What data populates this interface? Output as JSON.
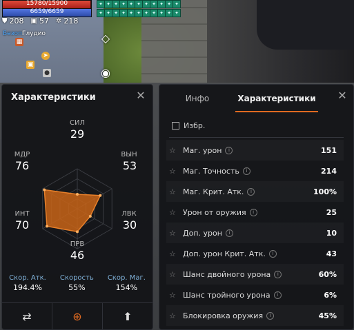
{
  "hud": {
    "hp_text": "15780/15900",
    "hp_fraction": 0.9925,
    "mp_text": "6659/6659",
    "mp_fraction": 1.0,
    "stats": [
      {
        "icon": "shield-icon",
        "glyph": "⛊",
        "value": "208"
      },
      {
        "icon": "helmet-icon",
        "glyph": "▣",
        "value": "57"
      },
      {
        "icon": "gear-icon",
        "glyph": "✲",
        "value": "218"
      }
    ],
    "zone_prefix": "Безоп",
    "zone_name": "Глудио",
    "colors": {
      "zone_safe": "#4aa8ff",
      "buff": "#1a8a6a"
    }
  },
  "left_panel": {
    "title": "Характеристики",
    "stats": {
      "str": {
        "label": "СИЛ",
        "value": "29"
      },
      "con": {
        "label": "ВЫН",
        "value": "53"
      },
      "dex": {
        "label": "ЛВК",
        "value": "30"
      },
      "wit": {
        "label": "ПРВ",
        "value": "46"
      },
      "int": {
        "label": "ИНТ",
        "value": "70"
      },
      "men": {
        "label": "МДР",
        "value": "76"
      }
    },
    "radar_max": 80,
    "speeds": [
      {
        "label": "Скор. Атк.",
        "value": "194.4%"
      },
      {
        "label": "Скорость",
        "value": "55%"
      },
      {
        "label": "Скор. Маг.",
        "value": "154%"
      }
    ],
    "buttons": [
      {
        "name": "swap-button",
        "glyph": "⇄"
      },
      {
        "name": "zoom-button",
        "glyph": "⊕"
      },
      {
        "name": "up-button",
        "glyph": "⬆"
      }
    ],
    "colors": {
      "accent": "#e06a20",
      "radar_fill": "#c86418"
    }
  },
  "right_panel": {
    "tabs": [
      {
        "label": "Инфо",
        "active": false
      },
      {
        "label": "Характеристики",
        "active": true
      }
    ],
    "favorites_label": "Избр.",
    "rows": [
      {
        "label": "Маг. урон",
        "value": "151"
      },
      {
        "label": "Маг. Точность",
        "value": "214"
      },
      {
        "label": "Маг. Крит. Атк.",
        "value": "100%"
      },
      {
        "label": "Урон от оружия",
        "value": "25"
      },
      {
        "label": "Доп. урон",
        "value": "10"
      },
      {
        "label": "Доп. урон Крит. Атк.",
        "value": "43"
      },
      {
        "label": "Шанс двойного урона",
        "value": "60%"
      },
      {
        "label": "Шанс тройного урона",
        "value": "6%"
      },
      {
        "label": "Блокировка оружия",
        "value": "45%"
      }
    ]
  }
}
